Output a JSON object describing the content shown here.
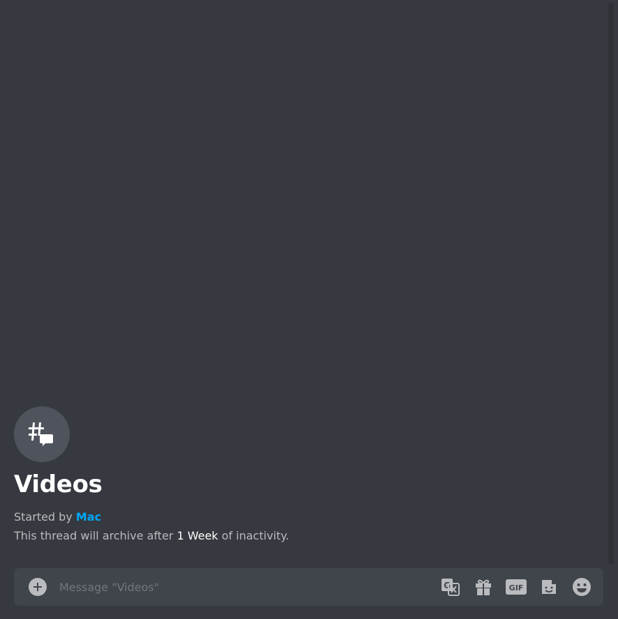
{
  "thread": {
    "icon": "thread-hash-icon",
    "title": "Videos",
    "started_by_prefix": "Started by",
    "author": "Mac",
    "archive_prefix": "This thread will archive after",
    "archive_duration": "1 Week",
    "archive_suffix": "of inactivity."
  },
  "composer": {
    "placeholder": "Message \"Videos\"",
    "value": "",
    "buttons": [
      {
        "icon": "add-attachment-icon"
      },
      {
        "icon": "translate-icon"
      },
      {
        "icon": "gift-icon"
      },
      {
        "icon": "gif-icon",
        "label": "GIF"
      },
      {
        "icon": "sticker-icon"
      },
      {
        "icon": "emoji-icon"
      }
    ]
  },
  "colors": {
    "background": "#36393f",
    "composer_bg": "#40444b",
    "icon_circle": "#4f545c",
    "author_link": "#00a8fc",
    "muted_text": "#b9bbbe",
    "placeholder": "#72767d",
    "icon_fill": "#b9bbbe"
  }
}
